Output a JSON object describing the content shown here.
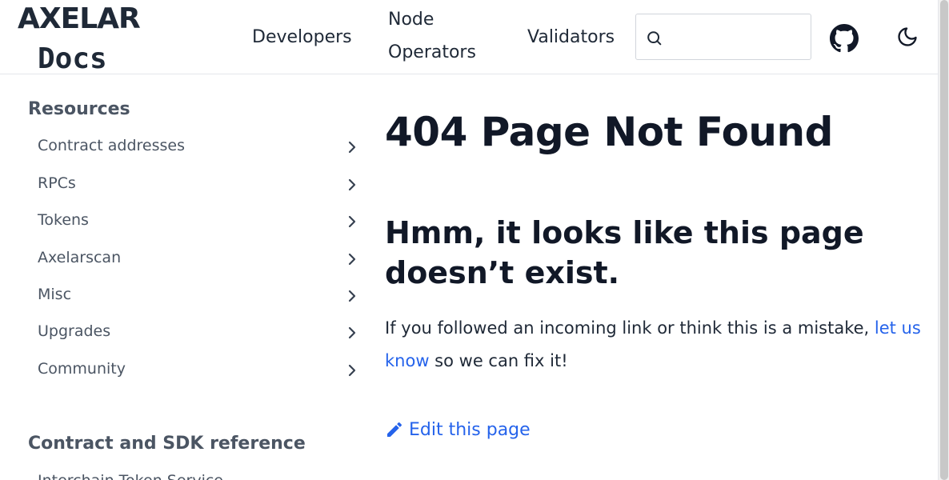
{
  "header": {
    "logo_word": "AXELAR",
    "logo_sub": "Docs",
    "nav": {
      "developers": "Developers",
      "node_operators": "Node Operators",
      "validators": "Validators"
    },
    "search": {
      "value": "",
      "placeholder": ""
    },
    "icons": {
      "search": "search-icon",
      "github": "github-icon",
      "theme": "moon-icon"
    }
  },
  "sidebar": {
    "section1_title": "Resources",
    "items": [
      {
        "label": "Contract addresses"
      },
      {
        "label": "RPCs"
      },
      {
        "label": "Tokens"
      },
      {
        "label": "Axelarscan"
      },
      {
        "label": "Misc"
      },
      {
        "label": "Upgrades"
      },
      {
        "label": "Community"
      }
    ],
    "section2_title": "Contract and SDK reference",
    "partial_item": "Interchain Token Service"
  },
  "main": {
    "title": "404 Page Not Found",
    "subtitle": "Hmm, it looks like this page doesn’t exist.",
    "text_before_link": "If you followed an incoming link or think this is a mistake, ",
    "link_text": "let us know",
    "text_after_link": " so we can fix it!",
    "edit_label": "Edit this page"
  },
  "colors": {
    "link": "#2563eb",
    "text": "#111827",
    "muted": "#4b5563",
    "border": "#e5e7eb"
  }
}
